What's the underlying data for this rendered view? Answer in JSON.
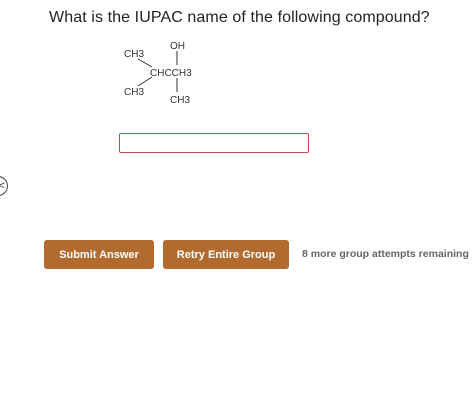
{
  "question": {
    "text": "What is the IUPAC name of the following compound?"
  },
  "structure": {
    "oh": "OH",
    "ch3_top_left": "CH3",
    "main_chain": "CHCCH3",
    "ch3_bottom_left": "CH3",
    "ch3_bottom": "CH3"
  },
  "answer_input": {
    "value": "",
    "placeholder": ""
  },
  "side_tab": {
    "icon": "chevron-left-icon",
    "glyph": "<"
  },
  "buttons": {
    "submit_label": "Submit Answer",
    "retry_label": "Retry Entire Group"
  },
  "attempts_text": "8 more group attempts remaining",
  "colors": {
    "button_bg": "#b36a2e",
    "input_border": "#c0504d"
  }
}
